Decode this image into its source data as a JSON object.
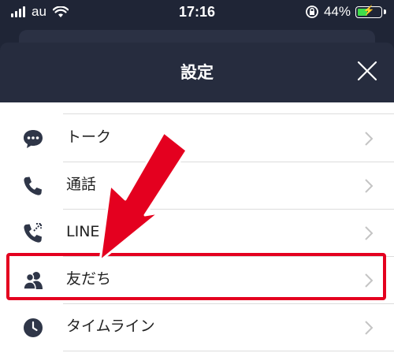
{
  "status": {
    "carrier": "au",
    "time": "17:16",
    "battery": "44%",
    "battery_level": 0.44
  },
  "header": {
    "title": "設定",
    "close_icon": "close-icon"
  },
  "settings": {
    "items": [
      {
        "label": "トーク",
        "icon": "chat-bubble-icon"
      },
      {
        "label": "通話",
        "icon": "phone-icon"
      },
      {
        "label": "LINE",
        "icon": "line-out-icon"
      },
      {
        "label": "友だち",
        "icon": "friends-icon"
      },
      {
        "label": "タイムライン",
        "icon": "clock-icon"
      }
    ]
  },
  "annotation": {
    "arrow_color": "#e4001f",
    "highlight_color": "#e4001f"
  },
  "colors": {
    "header_bg": "#262c3e",
    "icon_color": "#2f3648",
    "list_bg": "#ffffff"
  }
}
